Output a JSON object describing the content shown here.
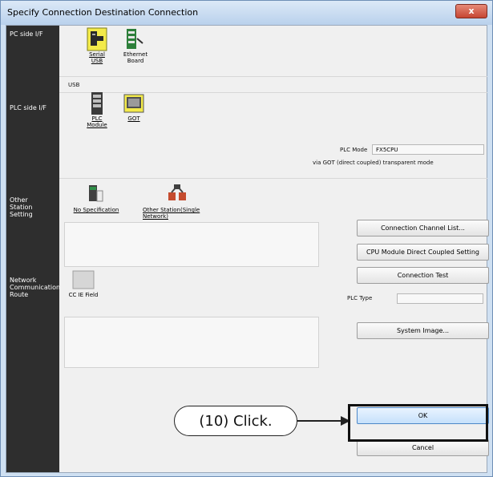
{
  "window": {
    "title": "Specify Connection Destination Connection",
    "close_label": "x"
  },
  "left_pane": {
    "pc_side": "PC side I/F",
    "plc_side": "PLC side I/F",
    "other_station": "Other\nStation\nSetting",
    "network_route": "Network\nCommunication\nRoute"
  },
  "pc_side": {
    "serial_usb": "Serial\nUSB",
    "ethernet_board": "Ethernet\nBoard",
    "status_text": "USB"
  },
  "plc_side": {
    "plc_module": "PLC\nModule",
    "got": "GOT",
    "plc_mode_label": "PLC Mode",
    "plc_mode_value": "FX5CPU",
    "via_text": "via GOT (direct coupled) transparent mode"
  },
  "other_station": {
    "no_specification": "No Specification",
    "other_station_single": "Other Station(Single\nNetwork)"
  },
  "network_route": {
    "cc_ie_field": "CC IE Field"
  },
  "buttons": {
    "connection_channel_list": "Connection Channel List...",
    "cpu_direct": "CPU Module Direct Coupled Setting",
    "connection_test": "Connection Test",
    "system_image": "System Image...",
    "ok": "OK",
    "cancel": "Cancel"
  },
  "plc_type": {
    "label": "PLC Type",
    "value": ""
  },
  "annotation": {
    "callout": "(10) Click."
  }
}
